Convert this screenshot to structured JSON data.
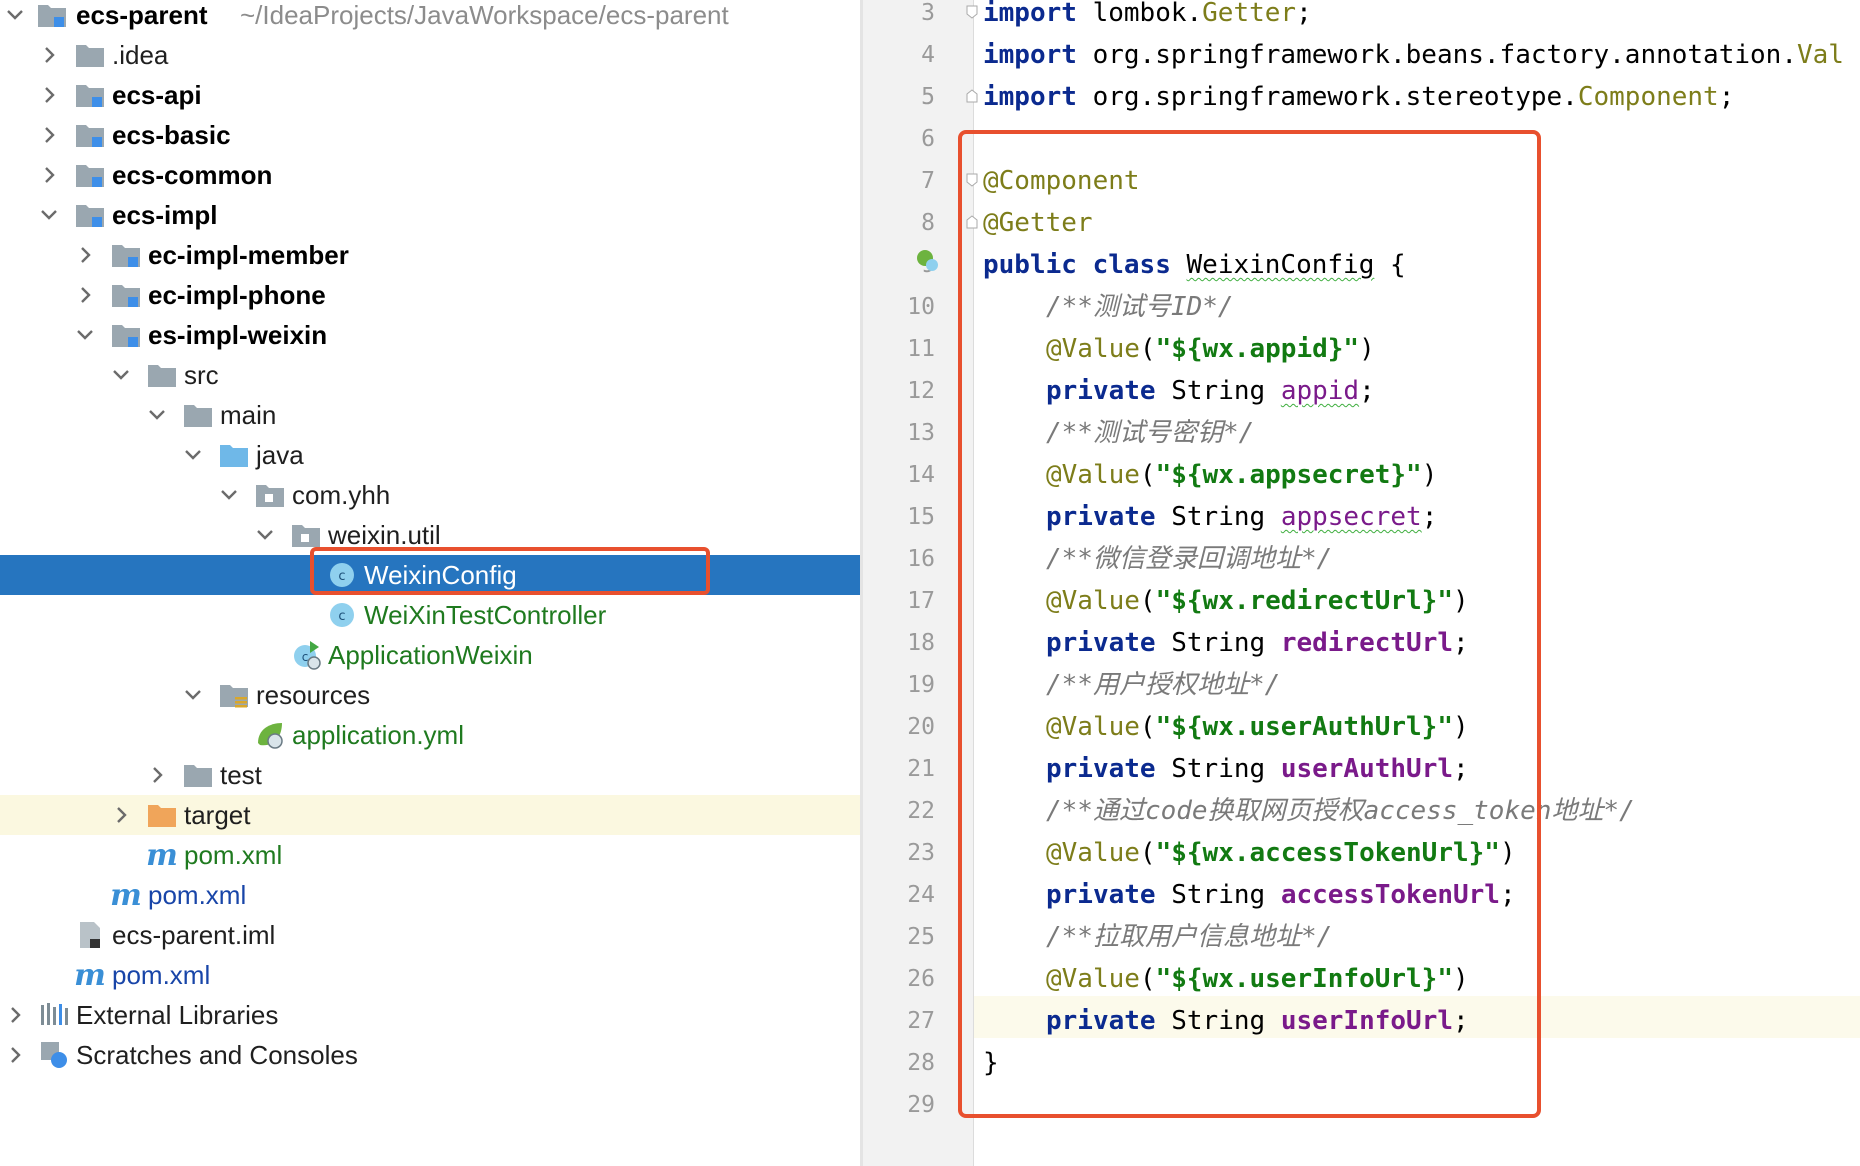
{
  "tree": {
    "rows": [
      {
        "label": "ecs-parent",
        "suffix": "~/IdeaProjects/JavaWorkspace/ecs-parent",
        "icon": "module-folder-icon",
        "style": "bold"
      },
      {
        "label": ".idea",
        "icon": "folder-icon",
        "style": "normal"
      },
      {
        "label": "ecs-api",
        "icon": "module-folder-icon",
        "style": "bold"
      },
      {
        "label": "ecs-basic",
        "icon": "module-folder-icon",
        "style": "bold"
      },
      {
        "label": "ecs-common",
        "icon": "module-folder-icon",
        "style": "bold"
      },
      {
        "label": "ecs-impl",
        "icon": "module-folder-icon",
        "style": "bold"
      },
      {
        "label": "ec-impl-member",
        "icon": "module-folder-icon",
        "style": "bold"
      },
      {
        "label": "ec-impl-phone",
        "icon": "module-folder-icon",
        "style": "bold"
      },
      {
        "label": "es-impl-weixin",
        "icon": "module-folder-icon",
        "style": "bold"
      },
      {
        "label": "src",
        "icon": "folder-icon",
        "style": "normal"
      },
      {
        "label": "main",
        "icon": "folder-icon",
        "style": "normal"
      },
      {
        "label": "java",
        "icon": "source-folder-icon",
        "style": "normal"
      },
      {
        "label": "com.yhh",
        "icon": "package-icon",
        "style": "normal"
      },
      {
        "label": "weixin.util",
        "icon": "package-icon",
        "style": "normal"
      },
      {
        "label": "WeixinConfig",
        "icon": "class-icon",
        "style": "selected"
      },
      {
        "label": "WeiXinTestController",
        "icon": "class-icon",
        "style": "green"
      },
      {
        "label": "ApplicationWeixin",
        "icon": "spring-class-icon",
        "style": "green"
      },
      {
        "label": "resources",
        "icon": "resources-folder-icon",
        "style": "normal"
      },
      {
        "label": "application.yml",
        "icon": "spring-config-icon",
        "style": "green"
      },
      {
        "label": "test",
        "icon": "folder-icon",
        "style": "normal"
      },
      {
        "label": "target",
        "icon": "excluded-folder-icon",
        "style": "normal"
      },
      {
        "label": "pom.xml",
        "icon": "maven-icon",
        "style": "green"
      },
      {
        "label": "pom.xml",
        "icon": "maven-icon",
        "style": "blue"
      },
      {
        "label": "ecs-parent.iml",
        "icon": "iml-file-icon",
        "style": "normal"
      },
      {
        "label": "pom.xml",
        "icon": "maven-icon",
        "style": "blue"
      },
      {
        "label": "External Libraries",
        "icon": "libraries-icon",
        "style": "normal"
      },
      {
        "label": "Scratches and Consoles",
        "icon": "scratches-icon",
        "style": "normal"
      }
    ]
  },
  "editor": {
    "line_numbers": [
      "3",
      "4",
      "5",
      "6",
      "7",
      "8",
      "9",
      "10",
      "11",
      "12",
      "13",
      "14",
      "15",
      "16",
      "17",
      "18",
      "19",
      "20",
      "21",
      "22",
      "23",
      "24",
      "25",
      "26",
      "27",
      "28",
      "29"
    ],
    "lines": {
      "l3_kw": "import",
      "l3_rest": " lombok.",
      "l3_ann": "Getter",
      "l3_end": ";",
      "l4_kw": "import",
      "l4_rest": " org.springframework.beans.factory.annotation.",
      "l4_ann": "Val",
      "l5_kw": "import",
      "l5_rest": " org.springframework.stereotype.",
      "l5_ann": "Component",
      "l5_end": ";",
      "l7": "@Component",
      "l8": "@Getter",
      "l9_kw1": "public",
      "l9_kw2": "class",
      "l9_name": "WeixinConfig",
      "l9_end": " {",
      "l10": "/**测试号ID*/",
      "l11_ann": "@Value",
      "l11_str": "\"${wx.appid}\"",
      "l12_kw": "private",
      "l12_type": " String ",
      "l12_fld": "appid",
      "l13": "/**测试号密钥*/",
      "l14_ann": "@Value",
      "l14_str": "\"${wx.appsecret}\"",
      "l15_kw": "private",
      "l15_type": " String ",
      "l15_fld": "appsecret",
      "l16": "/**微信登录回调地址*/",
      "l17_ann": "@Value",
      "l17_str": "\"${wx.redirectUrl}\"",
      "l18_kw": "private",
      "l18_type": " String ",
      "l18_fld": "redirectUrl",
      "l19": "/**用户授权地址*/",
      "l20_ann": "@Value",
      "l20_str": "\"${wx.userAuthUrl}\"",
      "l21_kw": "private",
      "l21_type": " String ",
      "l21_fld": "userAuthUrl",
      "l22": "/**通过code换取网页授权access_token地址*/",
      "l23_ann": "@Value",
      "l23_str": "\"${wx.accessTokenUrl}\"",
      "l24_kw": "private",
      "l24_type": " String ",
      "l24_fld": "accessTokenUrl",
      "l25": "/**拉取用户信息地址*/",
      "l26_ann": "@Value",
      "l26_str": "\"${wx.userInfoUrl}\"",
      "l27_kw": "private",
      "l27_type": " String ",
      "l27_fld": "userInfoUrl",
      "l28": "}"
    }
  }
}
